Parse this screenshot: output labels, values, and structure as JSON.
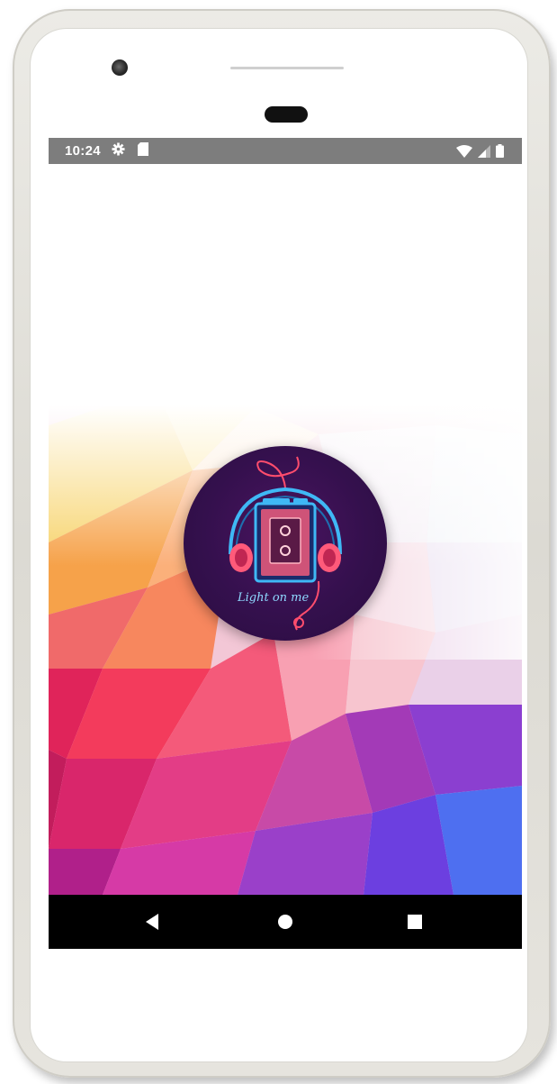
{
  "status_bar": {
    "time": "10:24",
    "left_icons": [
      "gear-icon",
      "sd-card-icon"
    ],
    "right_icons": [
      "wifi-icon",
      "cell-signal-icon",
      "battery-icon"
    ]
  },
  "splash": {
    "logo_text": "Light on me",
    "logo_icon": "cassette-headphones-icon"
  },
  "nav_bar": {
    "buttons": [
      "back-icon",
      "home-icon",
      "recents-icon"
    ]
  },
  "colors": {
    "status_bar_bg": "#7d7d7d",
    "nav_bar_bg": "#000000",
    "logo_bg": "#34104d",
    "accent_neon_blue": "#3fb8f5",
    "accent_neon_pink": "#ff4d6d"
  }
}
